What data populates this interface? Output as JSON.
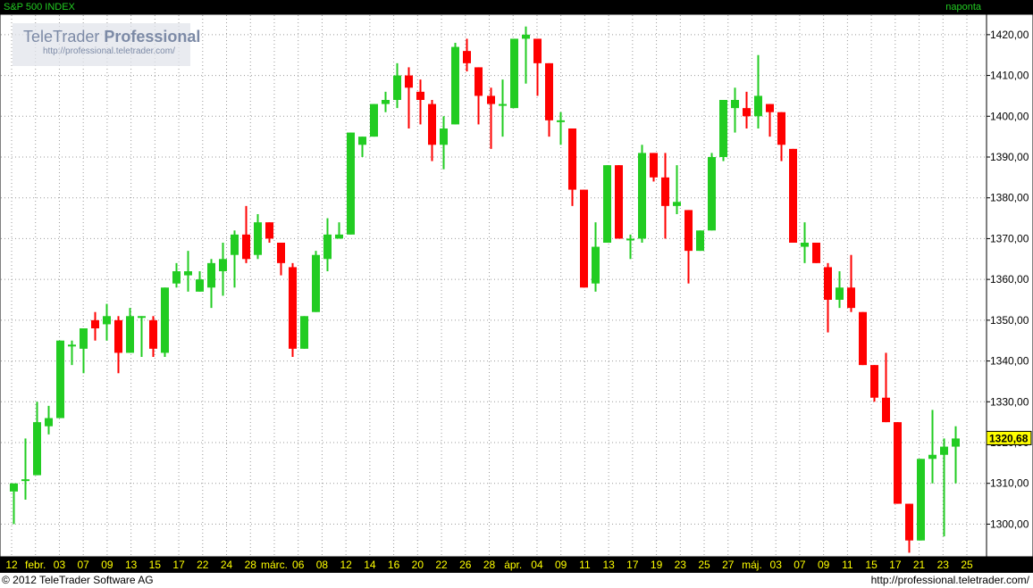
{
  "header": {
    "title": "S&P 500 INDEX",
    "mode": "naponta"
  },
  "footer": {
    "copyright": "© 2012 TeleTrader Software AG",
    "website": "http://professional.teletrader.com/"
  },
  "watermark": {
    "brand": "TeleTrader",
    "brand_bold": "Professional",
    "url": "http://professional.teletrader.com/"
  },
  "colors": {
    "up": "#22cc22",
    "down": "#ff0000",
    "grid": "#999999",
    "axis_bg": "#000000",
    "axis_text": "#ffff00",
    "last_price_bg": "#ffff00"
  },
  "chart_data": {
    "type": "candlestick",
    "title": "S&P 500 INDEX",
    "interval": "naponta",
    "ylim": [
      1292,
      1425
    ],
    "y_ticks": [
      1300,
      1310,
      1320,
      1330,
      1340,
      1350,
      1360,
      1370,
      1380,
      1390,
      1400,
      1410,
      1420
    ],
    "y_tick_labels": [
      "1300,00",
      "1310,00",
      "1320,00",
      "1330,00",
      "1340,00",
      "1350,00",
      "1360,00",
      "1370,00",
      "1380,00",
      "1390,00",
      "1400,00",
      "1410,00",
      "1420,00"
    ],
    "last_price": "1320,68",
    "grid": true,
    "x_tick_labels": [
      "12",
      "febr.",
      "03",
      "07",
      "09",
      "13",
      "15",
      "17",
      "22",
      "24",
      "28",
      "márc.",
      "06",
      "08",
      "12",
      "14",
      "16",
      "20",
      "22",
      "26",
      "28",
      "ápr.",
      "04",
      "09",
      "11",
      "13",
      "17",
      "19",
      "23",
      "25",
      "27",
      "máj.",
      "03",
      "07",
      "09",
      "11",
      "15",
      "17",
      "21",
      "23",
      "25"
    ],
    "ohlc": [
      [
        1308,
        1308,
        1300,
        1310
      ],
      [
        1311,
        1321,
        1306,
        1311
      ],
      [
        1312,
        1330,
        1312,
        1325
      ],
      [
        1324,
        1329,
        1322,
        1326
      ],
      [
        1326,
        1345,
        1326,
        1345
      ],
      [
        1344,
        1345,
        1339,
        1344
      ],
      [
        1343,
        1348,
        1337,
        1348
      ],
      [
        1350,
        1352,
        1345,
        1348
      ],
      [
        1349,
        1354,
        1345,
        1351
      ],
      [
        1350,
        1351,
        1337,
        1342
      ],
      [
        1342,
        1353,
        1342,
        1351
      ],
      [
        1351,
        1351,
        1341,
        1351
      ],
      [
        1350,
        1351,
        1341,
        1343
      ],
      [
        1342,
        1358,
        1341,
        1358
      ],
      [
        1359,
        1364,
        1358,
        1362
      ],
      [
        1361,
        1367,
        1357,
        1362
      ],
      [
        1357,
        1362,
        1357,
        1360
      ],
      [
        1358,
        1365,
        1353,
        1364
      ],
      [
        1362,
        1369,
        1356,
        1365
      ],
      [
        1366,
        1372,
        1358,
        1371
      ],
      [
        1371,
        1378,
        1364,
        1365
      ],
      [
        1366,
        1376,
        1365,
        1374
      ],
      [
        1374,
        1374,
        1369,
        1370
      ],
      [
        1369,
        1369,
        1361,
        1364
      ],
      [
        1363,
        1364,
        1341,
        1343
      ],
      [
        1343,
        1351,
        1343,
        1351
      ],
      [
        1352,
        1367,
        1352,
        1366
      ],
      [
        1365,
        1375,
        1362,
        1371
      ],
      [
        1370,
        1374,
        1370,
        1371
      ],
      [
        1371,
        1396,
        1371,
        1396
      ],
      [
        1393,
        1395,
        1390,
        1395
      ],
      [
        1395,
        1403,
        1395,
        1403
      ],
      [
        1403,
        1406,
        1401,
        1404
      ],
      [
        1404,
        1413,
        1402,
        1410
      ],
      [
        1410,
        1412,
        1397,
        1407
      ],
      [
        1406,
        1409,
        1398,
        1404
      ],
      [
        1403,
        1404,
        1389,
        1393
      ],
      [
        1393,
        1400,
        1387,
        1397
      ],
      [
        1398,
        1418,
        1398,
        1417
      ],
      [
        1416,
        1419,
        1411,
        1413
      ],
      [
        1412,
        1412,
        1398,
        1405
      ],
      [
        1405,
        1407,
        1392,
        1403
      ],
      [
        1403,
        1409,
        1395,
        1403
      ],
      [
        1402,
        1419,
        1402,
        1419
      ],
      [
        1419,
        1422,
        1408,
        1420
      ],
      [
        1419,
        1419,
        1405,
        1413
      ],
      [
        1413,
        1413,
        1395,
        1399
      ],
      [
        1399,
        1401,
        1393,
        1399
      ],
      [
        1397,
        1397,
        1378,
        1382
      ],
      [
        1382,
        1382,
        1358,
        1358
      ],
      [
        1359,
        1374,
        1357,
        1368
      ],
      [
        1369,
        1388,
        1369,
        1388
      ],
      [
        1388,
        1388,
        1370,
        1370
      ],
      [
        1370,
        1371,
        1365,
        1370
      ],
      [
        1370,
        1393,
        1369,
        1391
      ],
      [
        1391,
        1391,
        1384,
        1385
      ],
      [
        1385,
        1391,
        1370,
        1378
      ],
      [
        1378,
        1388,
        1376,
        1379
      ],
      [
        1377,
        1377,
        1359,
        1367
      ],
      [
        1367,
        1372,
        1367,
        1372
      ],
      [
        1372,
        1391,
        1372,
        1390
      ],
      [
        1390,
        1404,
        1389,
        1404
      ],
      [
        1402,
        1407,
        1396,
        1404
      ],
      [
        1402,
        1406,
        1397,
        1400
      ],
      [
        1400,
        1415,
        1397,
        1405
      ],
      [
        1403,
        1403,
        1395,
        1401
      ],
      [
        1401,
        1401,
        1389,
        1393
      ],
      [
        1392,
        1392,
        1369,
        1369
      ],
      [
        1368,
        1374,
        1364,
        1369
      ],
      [
        1369,
        1369,
        1364,
        1364
      ],
      [
        1363,
        1364,
        1347,
        1355
      ],
      [
        1355,
        1362,
        1353,
        1358
      ],
      [
        1358,
        1366,
        1352,
        1353
      ],
      [
        1352,
        1352,
        1339,
        1339
      ],
      [
        1339,
        1339,
        1330,
        1331
      ],
      [
        1331,
        1342,
        1325,
        1325
      ],
      [
        1325,
        1325,
        1305,
        1305
      ],
      [
        1305,
        1305,
        1293,
        1296
      ],
      [
        1296,
        1316,
        1296,
        1316
      ],
      [
        1316,
        1328,
        1310,
        1317
      ],
      [
        1317,
        1321,
        1297,
        1319
      ],
      [
        1319,
        1324,
        1310,
        1321
      ]
    ]
  }
}
